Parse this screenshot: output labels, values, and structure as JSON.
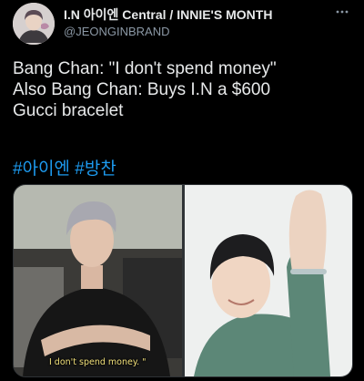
{
  "author": {
    "display_name": "I.N 아이엔 Central / INNIE'S MONTH",
    "handle": "@JEONGINBRAND",
    "avatar_icon": "profile-photo"
  },
  "tweet": {
    "lines": [
      "Bang Chan: \"I don't spend money\"",
      "Also Bang Chan: Buys I.N a $600",
      "Gucci bracelet"
    ],
    "hashtags": [
      "#아이엔",
      "#방찬"
    ]
  },
  "media": {
    "left_photo": {
      "subtitle": "I don't spend money. \""
    },
    "right_photo": {}
  },
  "icons": {
    "more": "more-horizontal-icon"
  },
  "colors": {
    "background": "#000000",
    "text_primary": "#e7e9ea",
    "text_secondary": "#8b98a5",
    "link": "#1d9bf0",
    "subtitle": "#f1e07a"
  }
}
